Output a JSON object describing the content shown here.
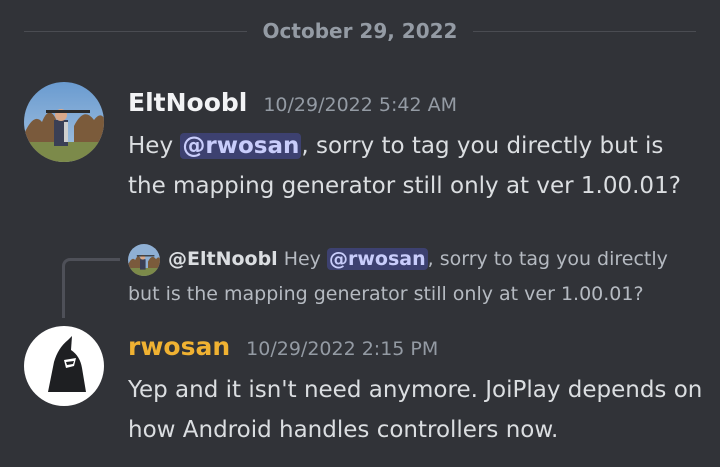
{
  "date_divider": {
    "label": "October 29, 2022"
  },
  "messages": [
    {
      "author": "EltNoobl",
      "timestamp": "10/29/2022 5:42 AM",
      "body_pre": "Hey ",
      "mention": "@rwosan",
      "body_post": ", sorry to tag you directly but is the mapping generator still only at ver 1.00.01?"
    },
    {
      "reply": {
        "author": "@EltNoobl",
        "text_pre": "Hey ",
        "mention": "@rwosan",
        "text_post": ", sorry to tag you directly but is the mapping generator still only at ver 1.00.01?"
      },
      "author": "rwosan",
      "author_color": "#f0b232",
      "timestamp": "10/29/2022 2:15 PM",
      "body": "Yep and it isn't need anymore. JoiPlay depends on how Android handles controllers now."
    }
  ]
}
